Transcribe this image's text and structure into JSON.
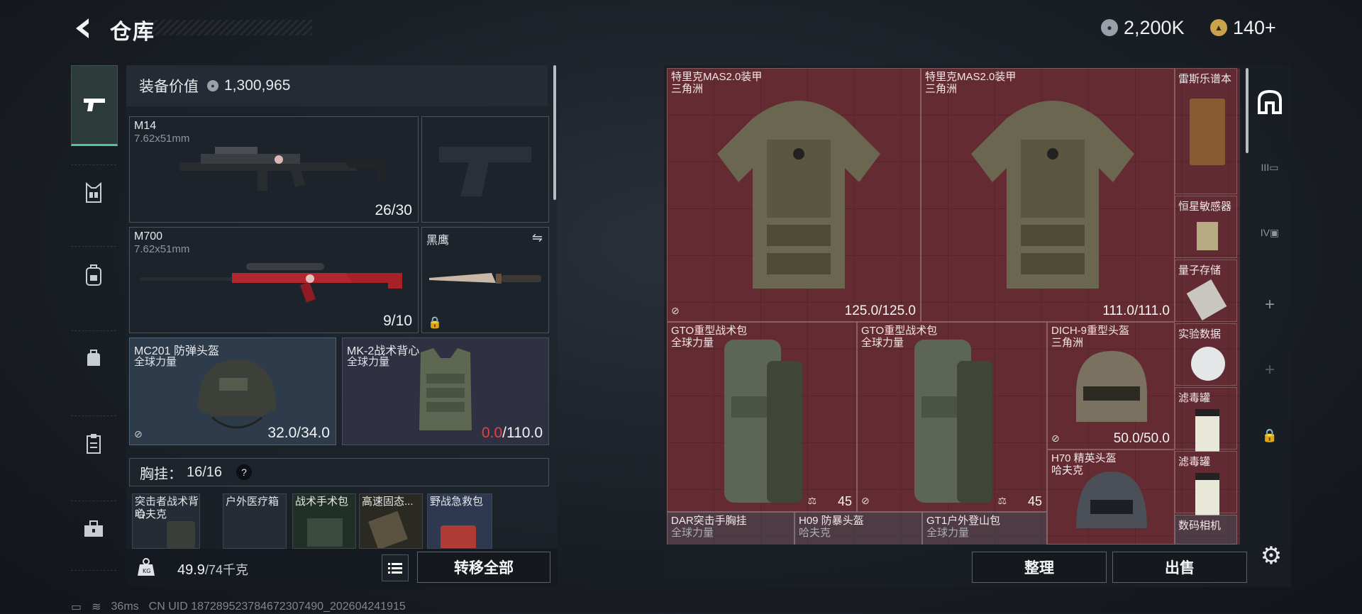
{
  "header": {
    "title": "仓库",
    "currency": [
      {
        "icon": "silver-coin-icon",
        "value": "2,200K"
      },
      {
        "icon": "gold-coin-icon",
        "value": "140+"
      }
    ]
  },
  "left_rail": {
    "items": [
      {
        "icon": "pistol-icon",
        "active": true
      },
      {
        "icon": "chest-rig-icon"
      },
      {
        "icon": "backpack-icon"
      },
      {
        "icon": "pouch-icon"
      },
      {
        "icon": "clipboard-icon"
      },
      {
        "icon": "toolbox-icon"
      }
    ]
  },
  "stash": {
    "value_label": "装备价值",
    "value": "1,300,965",
    "primary_weapon": {
      "name": "M14",
      "caliber": "7.62x51mm",
      "ammo": "26/30"
    },
    "sidearm": {
      "name": "",
      "empty": true
    },
    "secondary_weapon": {
      "name": "M700",
      "caliber": "7.62x51mm",
      "ammo": "9/10"
    },
    "melee": {
      "name": "黑鹰"
    },
    "helmet": {
      "name": "MC201 防弹头盔",
      "origin": "全球力量",
      "durability": "32.0/34.0"
    },
    "armor": {
      "name": "MK-2战术背心",
      "origin": "全球力量",
      "durability_current": "0.0",
      "durability_max": "/110.0"
    },
    "chest_rig": {
      "label": "胸挂：",
      "capacity": "16/16",
      "help": "?"
    },
    "chest_items": [
      {
        "name": "突击者战术背心",
        "origin": "哈夫克"
      },
      {
        "name": "户外医疗箱"
      },
      {
        "name": "战术手术包"
      },
      {
        "name": "高速固态..."
      },
      {
        "name": "野战急救包"
      }
    ],
    "weight_current": "49.9",
    "weight_max": "/74千克",
    "transfer_all": "转移全部"
  },
  "container": {
    "items": [
      {
        "name": "特里克MAS2.0装甲",
        "origin": "三角洲",
        "durability": "125.0/125.0"
      },
      {
        "name": "特里克MAS2.0装甲",
        "origin": "三角洲",
        "durability": "111.0/111.0"
      },
      {
        "name": "GTO重型战术包",
        "origin": "全球力量",
        "count": "45"
      },
      {
        "name": "GTO重型战术包",
        "origin": "全球力量",
        "count": "45"
      },
      {
        "name": "DICH-9重型头盔",
        "origin": "三角洲",
        "durability": "50.0/50.0"
      },
      {
        "name": "H70 精英头盔",
        "origin": "哈夫克"
      },
      {
        "name": "DAR突击手胸挂",
        "origin": "全球力量"
      },
      {
        "name": "H09 防暴头盔",
        "origin": "哈夫克"
      },
      {
        "name": "GT1户外登山包",
        "origin": "全球力量"
      }
    ],
    "side_items": [
      {
        "name": "雷斯乐谱本"
      },
      {
        "name": "恒星敏感器"
      },
      {
        "name": "量子存储"
      },
      {
        "name": "实验数据"
      },
      {
        "name": "滤毒罐"
      },
      {
        "name": "滤毒罐"
      },
      {
        "name": "数码相机"
      }
    ],
    "organize": "整理",
    "sell": "出售"
  },
  "right_tabs": [
    {
      "icon": "container-icon",
      "active": true
    },
    {
      "icon": "case-ii-icon",
      "label": "III"
    },
    {
      "icon": "case-iv-icon",
      "label": "IV"
    },
    {
      "icon": "add-icon"
    },
    {
      "icon": "add-icon"
    },
    {
      "icon": "lock-icon"
    }
  ],
  "status": {
    "ping": "36ms",
    "uid": "CN UID 1872895237846723074​90_202604241915"
  },
  "colors": {
    "accent": "#4fc79d",
    "danger": "#e0434b",
    "container_bg": "#5a2a31"
  }
}
